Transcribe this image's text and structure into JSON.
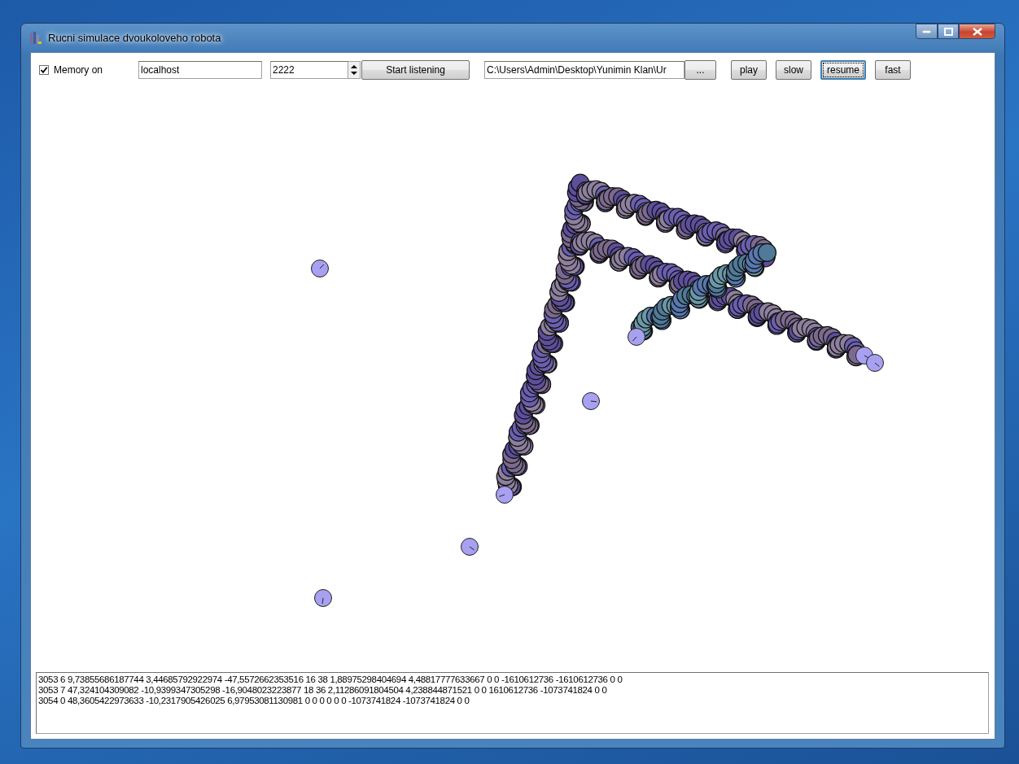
{
  "window": {
    "title": "Rucni simulace dvoukoloveho robota"
  },
  "toolbar": {
    "memory": {
      "label": "Memory on",
      "checked": true
    },
    "host": {
      "value": "localhost"
    },
    "port": {
      "value": "2222"
    },
    "listen_button": "Start listening",
    "path": {
      "value": "C:\\Users\\Admin\\Desktop\\Yunimin Klan\\Ur"
    },
    "browse_button": "...",
    "playback_buttons": [
      {
        "label": "play",
        "selected": false
      },
      {
        "label": "slow",
        "selected": false
      },
      {
        "label": "resume",
        "selected": true
      },
      {
        "label": "fast",
        "selected": false
      }
    ]
  },
  "log": [
    "3053 6 9,73855686187744 3,44685792922974 -47,5572662353516 16 38 1,88975298404694 4,48817777633667 0 0 -1610612736 -1610612736 0 0",
    "3053 7 47,324104309082 -10,9399347305298 -16,9048023223877 18 36 2,11286091804504 4,238844871521 0 0 1610612736 -1073741824 0 0",
    "3054 0 48,3605422973633 -10,2317905426025 6,97953081130981 0 0 0 0 0 0 -1073741824 -1073741824 0 0"
  ]
}
